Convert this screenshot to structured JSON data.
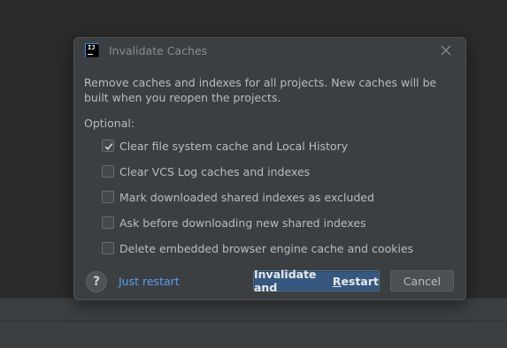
{
  "dialog": {
    "title": "Invalidate Caches",
    "app_icon": "intellij-idea-icon",
    "description": "Remove caches and indexes for all projects. New caches will be built when you reopen the projects.",
    "optional_label": "Optional:",
    "options": [
      {
        "label": "Clear file system cache and Local History",
        "checked": true
      },
      {
        "label": "Clear VCS Log caches and indexes",
        "checked": false
      },
      {
        "label": "Mark downloaded shared indexes as excluded",
        "checked": false
      },
      {
        "label": "Ask before downloading new shared indexes",
        "checked": false
      },
      {
        "label": "Delete embedded browser engine cache and cookies",
        "checked": false
      }
    ],
    "help_label": "?",
    "just_restart_label": "Just restart",
    "primary_button": {
      "before": "Invalidate and ",
      "mnemonic": "R",
      "after": "estart"
    },
    "cancel_label": "Cancel"
  },
  "colors": {
    "accent": "#365880",
    "link": "#589df6",
    "dialog_bg": "#3c3f41",
    "text": "#bbbbbb"
  }
}
